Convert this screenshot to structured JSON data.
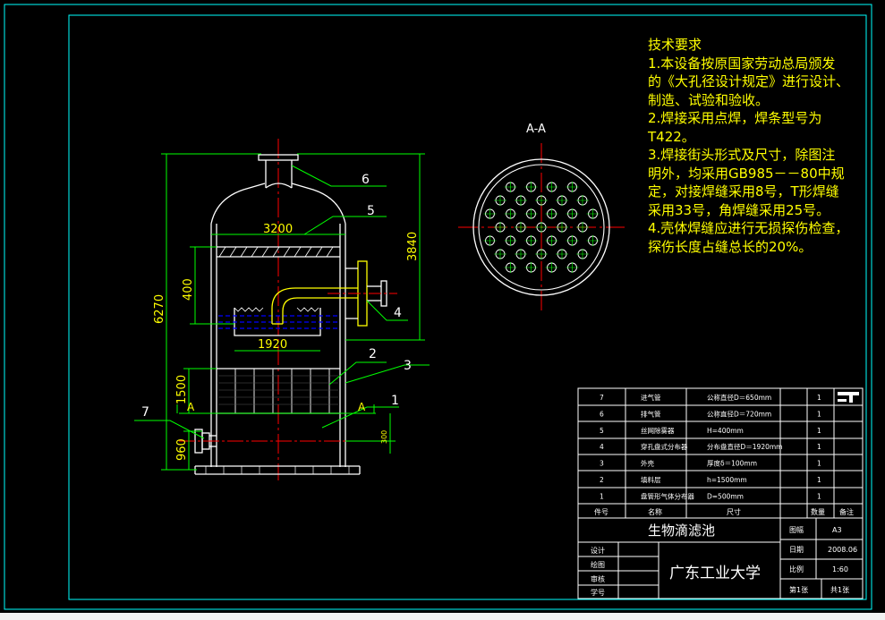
{
  "colors": {
    "background": "#000000",
    "frame": "#00ffff",
    "outline": "#ffffff",
    "dimension": "#00ff00",
    "centerline": "#ff0000",
    "text": "#ffff00",
    "hidden": "#0000ff"
  },
  "notes": {
    "heading": "技术要求",
    "lines": [
      "1.本设备按原国家劳动总局颁发",
      "的《大孔径设计规定》进行设计、",
      "制造、试验和验收。",
      "2.焊接采用点焊，焊条型号为",
      "T422。",
      "3.焊接街头形式及尺寸，除图注",
      "明外，均采用GB985－－80中规",
      "定，对接焊缝采用8号，T形焊缝",
      "采用33号，角焊缝采用25号。",
      "4.壳体焊缝应进行无损探伤检查，",
      "探伤长度占缝总长的20%。"
    ]
  },
  "section": {
    "label": "A-A"
  },
  "dims": {
    "width_top": "3200",
    "total_height": "6270",
    "upper_height": "3840",
    "d400": "400",
    "width_dist": "1920",
    "d1500": "1500",
    "d960": "960",
    "d300": "300",
    "section_mark_left": "A",
    "section_mark_right": "A"
  },
  "balloons": [
    "1",
    "2",
    "3",
    "4",
    "5",
    "6",
    "7"
  ],
  "parts_list": {
    "rows": [
      {
        "no": "7",
        "name": "进气管",
        "spec": "公称直径D＝650mm",
        "qty": "1",
        "note": ""
      },
      {
        "no": "6",
        "name": "排气管",
        "spec": "公称直径D＝720mm",
        "qty": "1",
        "note": ""
      },
      {
        "no": "5",
        "name": "丝网除雾器",
        "spec": "H=400mm",
        "qty": "1",
        "note": ""
      },
      {
        "no": "4",
        "name": "穿孔盘式分布器",
        "spec": "分布盘直径D＝1920mm",
        "qty": "1",
        "note": ""
      },
      {
        "no": "3",
        "name": "外壳",
        "spec": "厚度δ＝100mm",
        "qty": "1",
        "note": ""
      },
      {
        "no": "2",
        "name": "填料层",
        "spec": "h=1500mm",
        "qty": "1",
        "note": ""
      },
      {
        "no": "1",
        "name": "盘管形气体分布器",
        "spec": "D=500mm",
        "qty": "1",
        "note": ""
      }
    ],
    "header": {
      "no": "件号",
      "name": "名称",
      "spec": "尺寸",
      "qty": "数量",
      "note": "备注"
    }
  },
  "title_block": {
    "project": "生物滴滤池",
    "school": "广东工业大学",
    "roles": [
      "设计",
      "绘图",
      "审核",
      "学号"
    ],
    "labels": {
      "size": "图幅",
      "date": "日期",
      "scale": "比例",
      "sheet": "第1张",
      "total": "共1张"
    },
    "values": {
      "size": "A3",
      "date": "2008.06",
      "scale": "1:60"
    }
  }
}
